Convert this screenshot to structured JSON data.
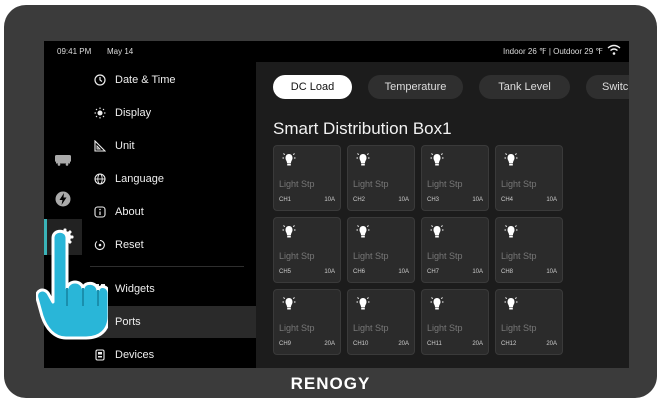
{
  "status": {
    "time": "09:41 PM",
    "date": "May 14",
    "weather": "Indoor 26 ℉  |  Outdoor 29 ℉"
  },
  "rail": [
    {
      "icon": "rv-icon"
    },
    {
      "icon": "bolt-icon"
    },
    {
      "icon": "gear-icon",
      "active": true
    }
  ],
  "menu": {
    "items": [
      {
        "label": "Date & Time",
        "icon": "clock-icon"
      },
      {
        "label": "Display",
        "icon": "brightness-icon"
      },
      {
        "label": "Unit",
        "icon": "ruler-icon"
      },
      {
        "label": "Language",
        "icon": "globe-icon"
      },
      {
        "label": "About",
        "icon": "info-icon"
      },
      {
        "label": "Reset",
        "icon": "reset-icon"
      },
      {
        "label": "Widgets",
        "icon": "widgets-icon"
      },
      {
        "label": "Ports",
        "icon": "ports-icon",
        "active": true
      },
      {
        "label": "Devices",
        "icon": "devices-icon"
      }
    ]
  },
  "tabs": [
    {
      "label": "DC Load",
      "active": true
    },
    {
      "label": "Temperature"
    },
    {
      "label": "Tank Level"
    },
    {
      "label": "Switc"
    }
  ],
  "section_title": "Smart Distribution Box1",
  "cards": [
    {
      "label": "Light Stp",
      "channel": "CH1",
      "amps": "10A"
    },
    {
      "label": "Light Stp",
      "channel": "CH2",
      "amps": "10A"
    },
    {
      "label": "Light Stp",
      "channel": "CH3",
      "amps": "10A"
    },
    {
      "label": "Light Stp",
      "channel": "CH4",
      "amps": "10A"
    },
    {
      "label": "Light Stp",
      "channel": "CH5",
      "amps": "10A"
    },
    {
      "label": "Light Stp",
      "channel": "CH6",
      "amps": "10A"
    },
    {
      "label": "Light Stp",
      "channel": "CH7",
      "amps": "10A"
    },
    {
      "label": "Light Stp",
      "channel": "CH8",
      "amps": "10A"
    },
    {
      "label": "Light Stp",
      "channel": "CH9",
      "amps": "20A"
    },
    {
      "label": "Light Stp",
      "channel": "CH10",
      "amps": "20A"
    },
    {
      "label": "Light Stp",
      "channel": "CH11",
      "amps": "20A"
    },
    {
      "label": "Light Stp",
      "channel": "CH12",
      "amps": "20A"
    }
  ],
  "brand": "RENOGY",
  "colors": {
    "accent": "#3ab3b8",
    "hand": "#29b6d8"
  }
}
